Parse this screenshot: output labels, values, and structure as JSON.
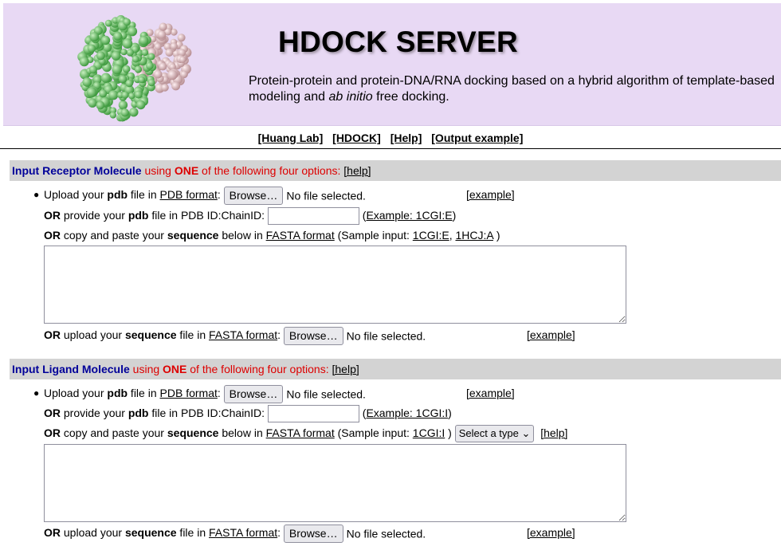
{
  "header": {
    "title": "HDOCK SERVER",
    "subtitle_pre": "Protein-protein and protein-DNA/RNA docking based on a hybrid algorithm of template-based modeling and ",
    "subtitle_em": "ab initio",
    "subtitle_post": " free docking.",
    "colors": {
      "background": "#e8d9f4",
      "receptor": "#78c878",
      "ligand": "#e8c0c4"
    }
  },
  "nav": [
    "[Huang Lab]",
    "[HDOCK]",
    "[Help]",
    "[Output example]"
  ],
  "receptor": {
    "head_blue": "Input Receptor Molecule",
    "head_red1": " using ",
    "head_bold": "ONE",
    "head_red2": " of the following four options:",
    "head_help": "[help]",
    "upload": {
      "pre": "Upload your ",
      "b": "pdb",
      "mid": " file in ",
      "link": "PDB format",
      "post": ":",
      "browse": "Browse…",
      "nofile": "No file selected.",
      "example": "[example]"
    },
    "pdbid": {
      "or": "OR",
      "pre": " provide your ",
      "b": "pdb",
      "post": " file in PDB ID:ChainID:",
      "value": "",
      "ex_open": "(",
      "ex_link": "Example: 1CGI:E",
      "ex_close": ")"
    },
    "seq": {
      "or": "OR",
      "pre": " copy and paste your ",
      "b": "sequence",
      "mid": " below in ",
      "link": "FASTA format",
      "sample_pre": " (Sample input: ",
      "s1": "1CGI:E",
      "comma": ", ",
      "s2": "1HCJ:A",
      "sample_post": " )"
    },
    "textarea": "",
    "seqfile": {
      "or": "OR",
      "pre": " upload your ",
      "b": "sequence",
      "mid": " file in ",
      "link": "FASTA format",
      "post": ":",
      "browse": "Browse…",
      "nofile": "No file selected.",
      "example": "[example]"
    }
  },
  "ligand": {
    "head_blue": "Input Ligand Molecule",
    "head_red1": " using ",
    "head_bold": "ONE",
    "head_red2": " of the following four options:",
    "head_help": "[help]",
    "upload": {
      "pre": "Upload your ",
      "b": "pdb",
      "mid": " file in ",
      "link": "PDB format",
      "post": ":",
      "browse": "Browse…",
      "nofile": "No file selected.",
      "example": "[example]"
    },
    "pdbid": {
      "or": "OR",
      "pre": " provide your ",
      "b": "pdb",
      "post": " file in PDB ID:ChainID:",
      "value": "",
      "ex_open": "(",
      "ex_link": "Example: 1CGI:I",
      "ex_close": ")"
    },
    "seq": {
      "or": "OR",
      "pre": " copy and paste your ",
      "b": "sequence",
      "mid": " below in ",
      "link": "FASTA format",
      "sample_pre": " (Sample input: ",
      "s1": "1CGI:I",
      "sample_post": " )",
      "select": "Select a type",
      "help": "[help]"
    },
    "textarea": "",
    "seqfile": {
      "or": "OR",
      "pre": " upload your ",
      "b": "sequence",
      "mid": " file in ",
      "link": "FASTA format",
      "post": ":",
      "browse": "Browse…",
      "nofile": "No file selected.",
      "example": "[example]"
    }
  }
}
